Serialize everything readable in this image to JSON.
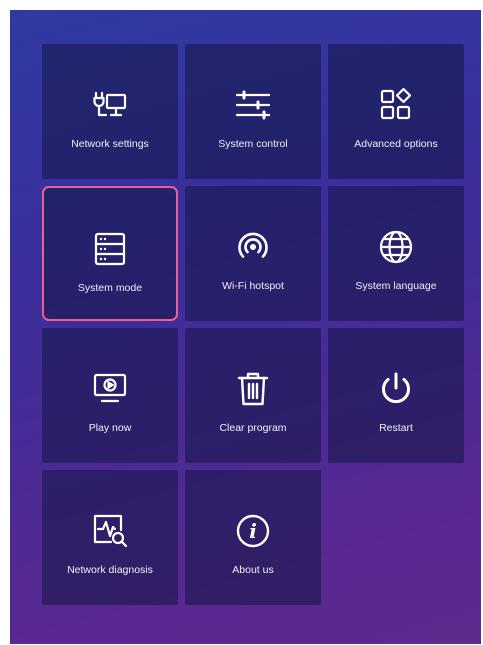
{
  "tiles": [
    {
      "label": "Network settings",
      "icon": "network-settings-icon"
    },
    {
      "label": "System control",
      "icon": "sliders-icon"
    },
    {
      "label": "Advanced options",
      "icon": "advanced-options-icon"
    },
    {
      "label": "System mode",
      "icon": "server-icon",
      "selected": true
    },
    {
      "label": "Wi-Fi hotspot",
      "icon": "hotspot-icon"
    },
    {
      "label": "System language",
      "icon": "globe-icon"
    },
    {
      "label": "Play now",
      "icon": "monitor-play-icon"
    },
    {
      "label": "Clear program",
      "icon": "trash-icon"
    },
    {
      "label": "Restart",
      "icon": "power-icon"
    },
    {
      "label": "Network diagnosis",
      "icon": "diagnosis-icon"
    },
    {
      "label": "About us",
      "icon": "info-icon"
    }
  ],
  "colors": {
    "selection_border": "#e8628e",
    "background_top": "#2f3aa0",
    "background_bottom": "#5b2a8c"
  }
}
